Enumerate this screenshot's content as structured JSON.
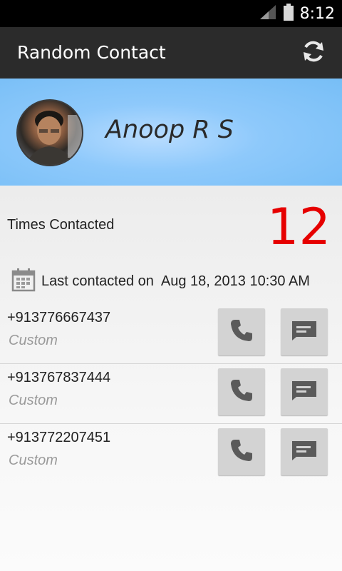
{
  "status_bar": {
    "time": "8:12",
    "icons": [
      "signal-icon",
      "battery-icon"
    ]
  },
  "action_bar": {
    "title": "Random Contact",
    "refresh_icon": "refresh-icon"
  },
  "contact": {
    "name": "Anoop R S"
  },
  "stats": {
    "times_contacted_label": "Times Contacted",
    "times_contacted_value": "12",
    "last_contacted_label": "Last contacted on",
    "last_contacted_value": "Aug 18, 2013 10:30 AM"
  },
  "phones": [
    {
      "number": "+913776667437",
      "type": "Custom"
    },
    {
      "number": "+913767837444",
      "type": "Custom"
    },
    {
      "number": "+913772207451",
      "type": "Custom"
    }
  ],
  "colors": {
    "accent_red": "#e60000",
    "header_blue": "#8ec9fb",
    "action_bar": "#2b2b2b"
  }
}
